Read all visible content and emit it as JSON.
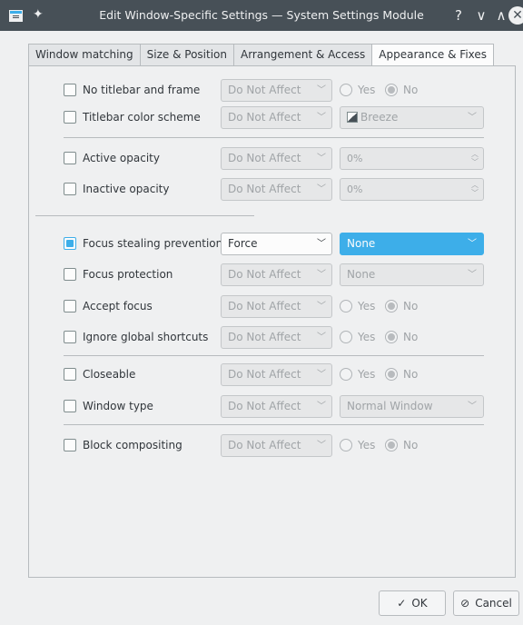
{
  "window": {
    "title": "Edit Window-Specific Settings — System Settings Module",
    "help_glyph": "?",
    "min_glyph": "∨",
    "max_glyph": "∧",
    "close_glyph": "✕"
  },
  "tabs": [
    {
      "label": "Window matching",
      "active": false
    },
    {
      "label": "Size & Position",
      "active": false
    },
    {
      "label": "Arrangement & Access",
      "active": false
    },
    {
      "label": "Appearance & Fixes",
      "active": true
    }
  ],
  "rows": {
    "no_titlebar": {
      "label": "No titlebar and frame",
      "checked": false,
      "combo": "Do Not Affect",
      "yes": "Yes",
      "no": "No"
    },
    "titlebar_color": {
      "label": "Titlebar color scheme",
      "checked": false,
      "combo": "Do Not Affect",
      "value": "Breeze"
    },
    "active_opacity": {
      "label": "Active opacity",
      "checked": false,
      "combo": "Do Not Affect",
      "value": "0%"
    },
    "inactive_opacity": {
      "label": "Inactive opacity",
      "checked": false,
      "combo": "Do Not Affect",
      "value": "0%"
    },
    "focus_stealing": {
      "label": "Focus stealing prevention",
      "checked": true,
      "combo": "Force",
      "value": "None"
    },
    "focus_protection": {
      "label": "Focus protection",
      "checked": false,
      "combo": "Do Not Affect",
      "value": "None"
    },
    "accept_focus": {
      "label": "Accept focus",
      "checked": false,
      "combo": "Do Not Affect",
      "yes": "Yes",
      "no": "No"
    },
    "ignore_shortcuts": {
      "label": "Ignore global shortcuts",
      "checked": false,
      "combo": "Do Not Affect",
      "yes": "Yes",
      "no": "No"
    },
    "closeable": {
      "label": "Closeable",
      "checked": false,
      "combo": "Do Not Affect",
      "yes": "Yes",
      "no": "No"
    },
    "window_type": {
      "label": "Window type",
      "checked": false,
      "combo": "Do Not Affect",
      "value": "Normal Window"
    },
    "block_compositing": {
      "label": "Block compositing",
      "checked": false,
      "combo": "Do Not Affect",
      "yes": "Yes",
      "no": "No"
    }
  },
  "buttons": {
    "ok": "OK",
    "cancel": "Cancel"
  },
  "colors": {
    "accent": "#3daee9",
    "titlebar": "#475057",
    "background": "#eff0f1"
  }
}
